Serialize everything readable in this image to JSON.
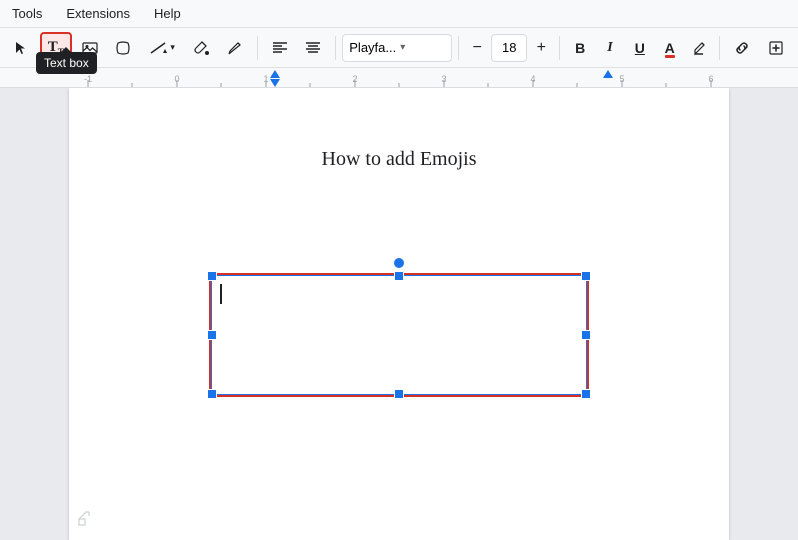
{
  "menubar": {
    "items": [
      "Tools",
      "Extensions",
      "Help"
    ]
  },
  "toolbar": {
    "select_icon": "↖",
    "textbox_icon": "T",
    "image_icon": "🖼",
    "shapes_icon": "◻",
    "line_icon": "╱",
    "paintbucket_icon": "🪣",
    "pen_icon": "✏",
    "align_left_icon": "≡",
    "align_icon": "≣",
    "font_name": "Playfа...",
    "font_size": "18",
    "decrease_size": "−",
    "increase_size": "+",
    "bold": "B",
    "italic": "I",
    "underline": "U",
    "text_color": "A",
    "highlight": "A",
    "link": "🔗",
    "insert": "⊞"
  },
  "ruler": {
    "markers": [
      "-1",
      "0",
      "1",
      "2",
      "3",
      "4",
      "5",
      "6"
    ]
  },
  "document": {
    "title": "How to add Emojis"
  },
  "tooltip": {
    "label": "Text box"
  },
  "textbox": {
    "content": ""
  }
}
